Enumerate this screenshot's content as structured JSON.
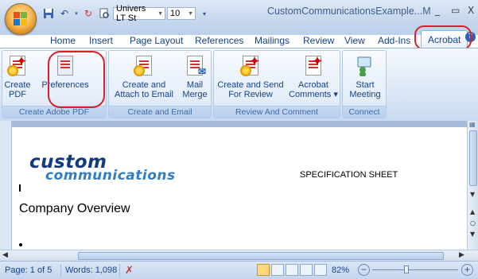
{
  "quick_access": {
    "font_name": "Univers LT St",
    "font_size": "10"
  },
  "window": {
    "title": "CustomCommunicationsExample...M",
    "minimize": "_",
    "restore": "▭",
    "close": "X"
  },
  "tabs": [
    "Home",
    "Insert",
    "Page Layout",
    "References",
    "Mailings",
    "Review",
    "View",
    "Add-Ins",
    "Acrobat"
  ],
  "active_tab": "Acrobat",
  "help_label": "?",
  "ribbon": {
    "groups": [
      {
        "label": "Create Adobe PDF",
        "buttons": [
          {
            "line1": "Create",
            "line2": "PDF"
          },
          {
            "line1": "Preferences",
            "line2": ""
          }
        ]
      },
      {
        "label": "Create and Email",
        "buttons": [
          {
            "line1": "Create and",
            "line2": "Attach to Email"
          },
          {
            "line1": "Mail",
            "line2": "Merge"
          }
        ]
      },
      {
        "label": "Review And Comment",
        "buttons": [
          {
            "line1": "Create and Send",
            "line2": "For Review"
          },
          {
            "line1": "Acrobat",
            "line2": "Comments ▾"
          }
        ]
      },
      {
        "label": "Connect",
        "buttons": [
          {
            "line1": "Start",
            "line2": "Meeting"
          }
        ]
      }
    ]
  },
  "document": {
    "logo_line1": "custom",
    "logo_line2": "communications",
    "spec_sheet": "SPECIFICATION SHEET",
    "heading": "Company Overview"
  },
  "status": {
    "page": "Page: 1 of 5",
    "words": "Words: 1,098",
    "zoom": "82%",
    "zoom_level_percent": 82
  },
  "colors": {
    "annotation": "#d8202a",
    "logo_dark": "#123a7a",
    "logo_light": "#2f7ec3"
  }
}
